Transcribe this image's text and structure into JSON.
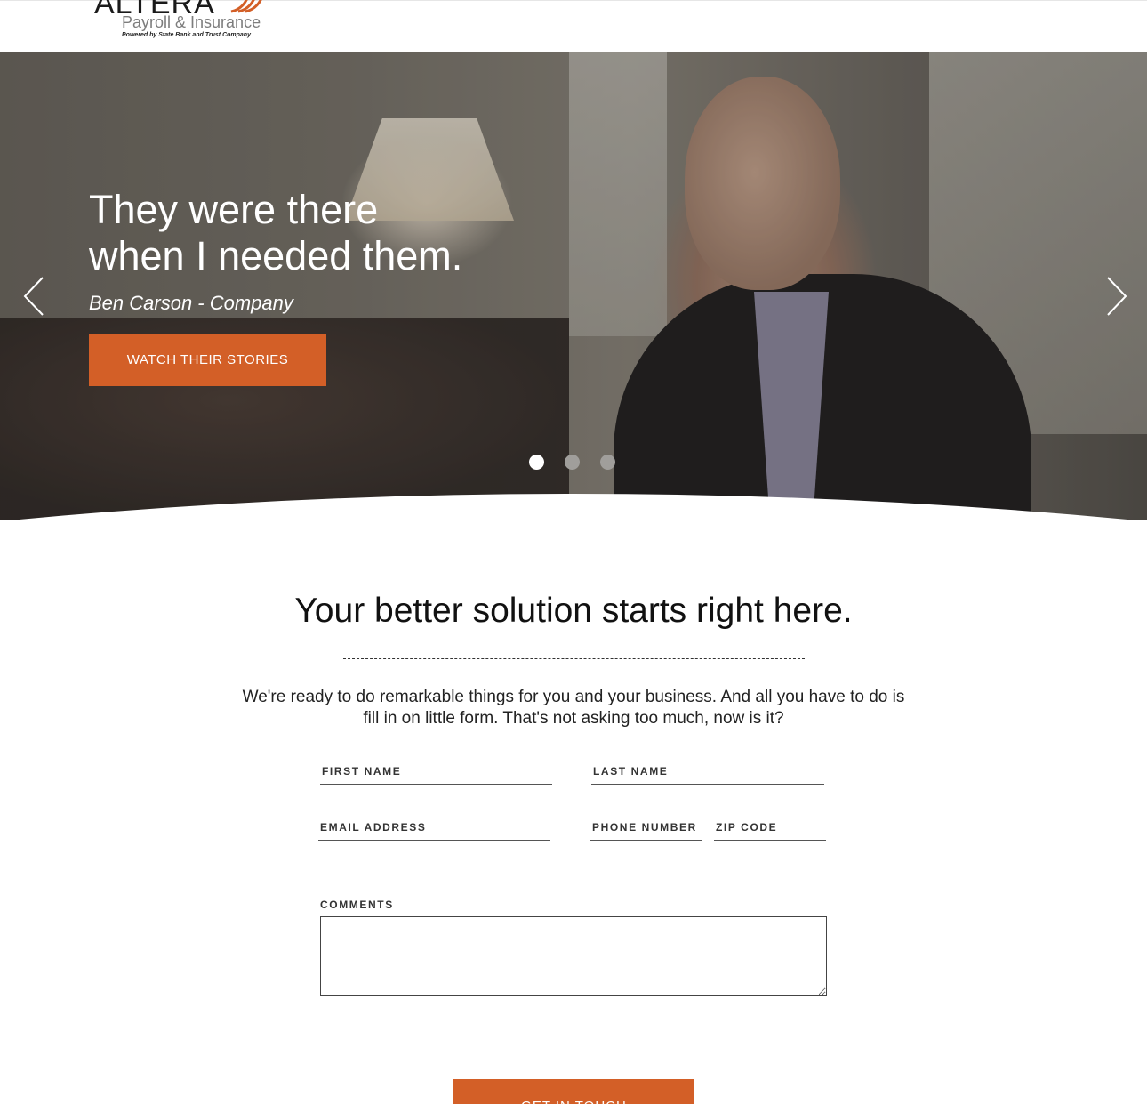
{
  "header": {
    "logo_word": "ALTERA",
    "logo_sub": "Payroll & Insurance",
    "logo_powered": "Powered by State Bank and Trust Company"
  },
  "hero": {
    "title_line1": "They were there",
    "title_line2": "when I needed them.",
    "caption": "Ben Carson - Company",
    "button_label": "WATCH THEIR STORIES",
    "slides": 3,
    "active_slide": 1
  },
  "form_section": {
    "title": "Your better solution starts right here.",
    "text": "We're ready to do remarkable things for you and your business. And all you have to do is fill in on little form. That's not asking too much, now is it?",
    "fields": {
      "first_name": "FIRST NAME",
      "last_name": "LAST NAME",
      "email": "EMAIL ADDRESS",
      "phone": "PHONE NUMBER",
      "zip": "ZIP CODE",
      "comments": "COMMENTS"
    },
    "submit_label": "GET IN TOUCH"
  },
  "colors": {
    "accent": "#d35f27"
  }
}
